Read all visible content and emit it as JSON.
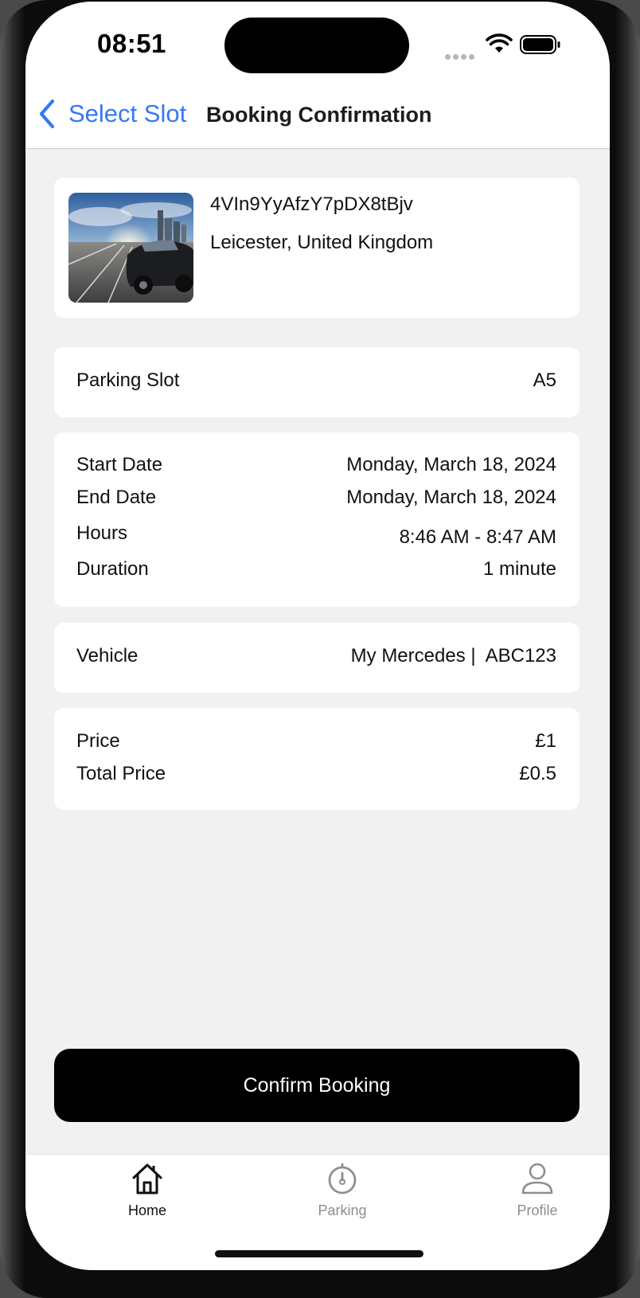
{
  "status_bar": {
    "time": "08:51"
  },
  "nav": {
    "back_label": "Select Slot",
    "title": "Booking Confirmation"
  },
  "location": {
    "id": "4VIn9YyAfzY7pDX8tBjv",
    "address": "Leicester, United Kingdom",
    "thumbnail_icon": "parking-photo"
  },
  "slot": {
    "label": "Parking Slot",
    "value": "A5"
  },
  "schedule": {
    "start_label": "Start Date",
    "start_value": "Monday, March 18, 2024",
    "end_label": "End Date",
    "end_value": "Monday, March 18, 2024",
    "hours_label": "Hours",
    "hours_value": "8:46 AM - 8:47 AM",
    "duration_label": "Duration",
    "duration_value": "1 minute"
  },
  "vehicle": {
    "label": "Vehicle",
    "value": "My Mercedes |  ABC123"
  },
  "pricing": {
    "price_label": "Price",
    "price_value": "£1",
    "total_label": "Total Price",
    "total_value": "£0.5"
  },
  "confirm_button": "Confirm Booking",
  "tabs": [
    {
      "label": "Home",
      "icon": "home-icon",
      "active": true
    },
    {
      "label": "Parking",
      "icon": "parking-timer-icon",
      "active": false
    },
    {
      "label": "Profile",
      "icon": "person-icon",
      "active": false
    }
  ],
  "colors": {
    "accent": "#3478f6",
    "background": "#f1f1f1",
    "card": "#ffffff",
    "button": "#000000",
    "tab_inactive": "#8e8e8e"
  }
}
